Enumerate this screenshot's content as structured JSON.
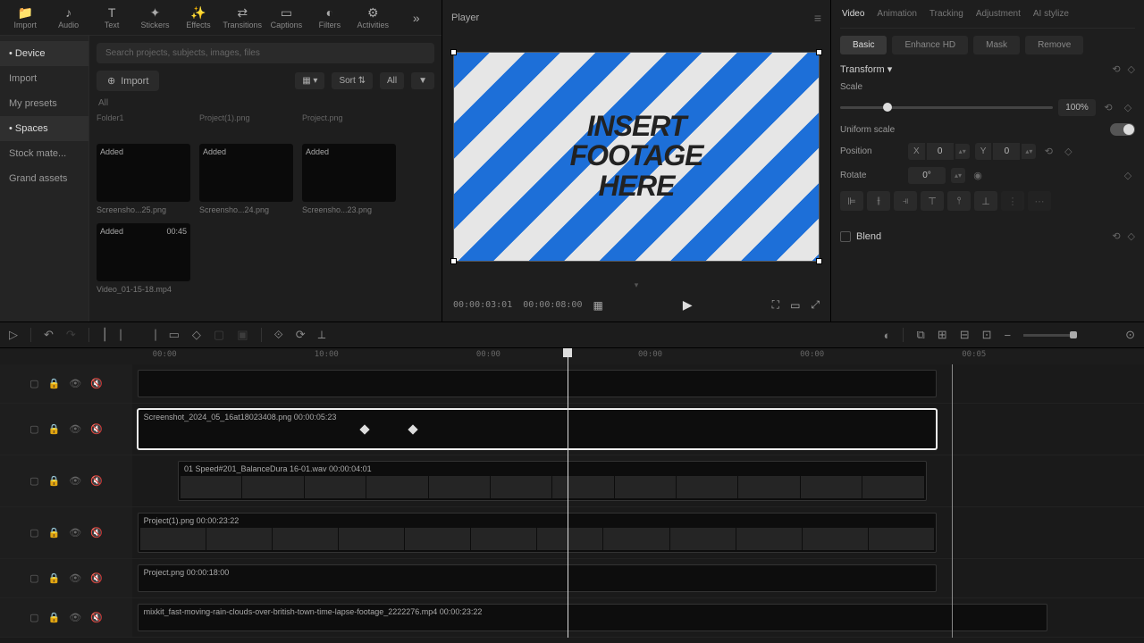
{
  "toolbar": [
    {
      "icon": "📁",
      "label": "Import"
    },
    {
      "icon": "♪",
      "label": "Audio"
    },
    {
      "icon": "T",
      "label": "Text"
    },
    {
      "icon": "✦",
      "label": "Stickers"
    },
    {
      "icon": "✨",
      "label": "Effects"
    },
    {
      "icon": "⇄",
      "label": "Transitions"
    },
    {
      "icon": "▭",
      "label": "Captions"
    },
    {
      "icon": "◐",
      "label": "Filters"
    },
    {
      "icon": "⚙",
      "label": "Activities"
    }
  ],
  "search_placeholder": "Search projects, subjects, images, files",
  "sidebar": [
    {
      "label": "Device",
      "active": true
    },
    {
      "label": "Import",
      "active": false
    },
    {
      "label": "My presets",
      "active": false
    },
    {
      "label": "Spaces",
      "active": true
    },
    {
      "label": "Stock mate...",
      "active": false
    },
    {
      "label": "Grand assets",
      "active": false
    }
  ],
  "import_btn": "Import",
  "sort_label": "Sort",
  "all_label": "All",
  "category": "All",
  "folder_name": "Folder1",
  "thumbs": [
    {
      "name": "Project(1).png",
      "added": "",
      "dur": ""
    },
    {
      "name": "Project.png",
      "added": "",
      "dur": ""
    },
    {
      "name": "Screensho...25.png",
      "added": "Added",
      "dur": ""
    },
    {
      "name": "Screensho...24.png",
      "added": "Added",
      "dur": ""
    },
    {
      "name": "Screensho...23.png",
      "added": "Added",
      "dur": ""
    },
    {
      "name": "Video_01-15-18.mp4",
      "added": "Added",
      "dur": "00:45"
    }
  ],
  "player": {
    "title": "Player",
    "overlay_line1": "INSERT",
    "overlay_line2": "FOOTAGE",
    "overlay_line3": "HERE",
    "tc1": "00:00:03:01",
    "tc2": "00:00:08:00"
  },
  "right_tabs": [
    "Video",
    "Animation",
    "Tracking",
    "Adjustment",
    "AI stylize"
  ],
  "right_active_tab": 0,
  "sub_tabs": [
    "Basic",
    "Enhance HD",
    "Mask",
    "Remove"
  ],
  "sub_active": 0,
  "transform_label": "Transform",
  "scale": {
    "label": "Scale",
    "value": "100%",
    "pos": 20
  },
  "uniform": {
    "label": "Uniform scale",
    "on": true
  },
  "position": {
    "label": "Position",
    "x": "0",
    "y": "0"
  },
  "rotate": {
    "label": "Rotate",
    "value": "0°"
  },
  "blend": {
    "label": "Blend"
  },
  "ruler_ticks": [
    "00:00",
    "10:00",
    "00:00",
    "00:00",
    "00:00",
    "00:05"
  ],
  "playhead_pct": 43,
  "marker_pct": 81,
  "tracks": [
    {
      "tall": false,
      "clip": {
        "left": 0.5,
        "width": 79,
        "label": "",
        "selected": false
      }
    },
    {
      "tall": true,
      "clip": {
        "left": 0.5,
        "width": 79,
        "label": "Screenshot_2024_05_16at18023408.png  00:00:05:23",
        "selected": true,
        "keyframes": [
          28,
          34
        ]
      }
    },
    {
      "tall": true,
      "clip": {
        "left": 4.5,
        "width": 74,
        "label": "01 Speed#201_BalanceDura 16-01.wav  00:00:04:01",
        "selected": false,
        "has_thumbs": true
      }
    },
    {
      "tall": true,
      "clip": {
        "left": 0.5,
        "width": 79,
        "label": "Project(1).png  00:00:23:22",
        "selected": false,
        "has_thumbs": true
      }
    },
    {
      "tall": false,
      "clip": {
        "left": 0.5,
        "width": 79,
        "label": "Project.png  00:00:18:00",
        "selected": false
      }
    },
    {
      "tall": false,
      "clip": {
        "left": 0.5,
        "width": 90,
        "label": "mixkit_fast-moving-rain-clouds-over-british-town-time-lapse-footage_2222276.mp4  00:00:23:22",
        "selected": false
      }
    }
  ]
}
